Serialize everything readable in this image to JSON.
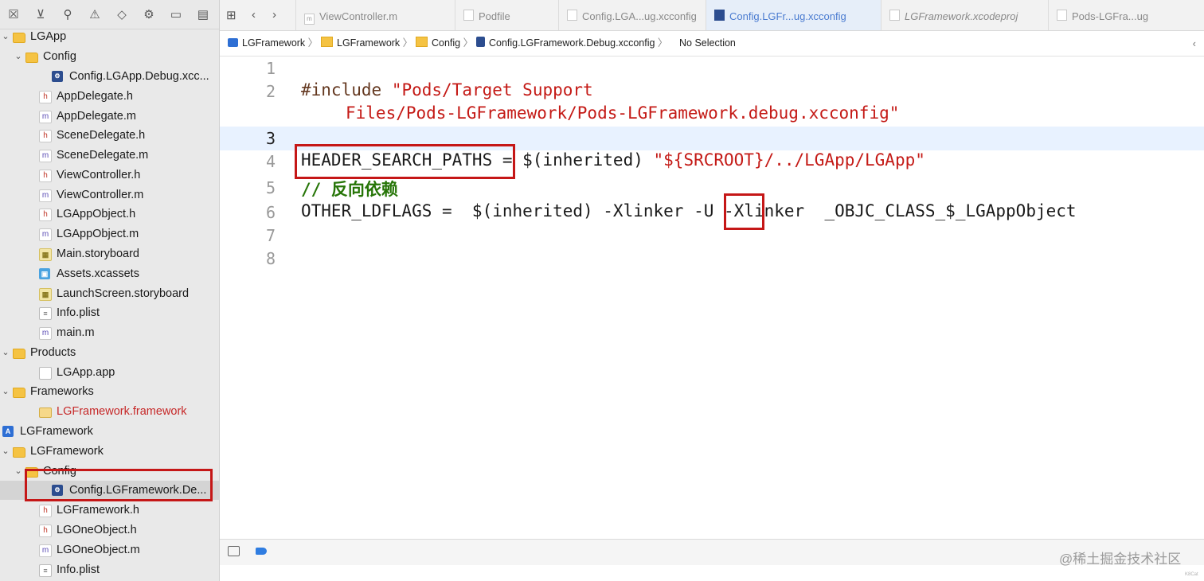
{
  "navigator": {
    "toolbar_icons": [
      "close-box-icon",
      "hierarchy-icon",
      "search-icon",
      "warning-icon",
      "diamond-icon",
      "test-icon",
      "breakpoint-icon",
      "report-icon"
    ],
    "rows": [
      {
        "label": "LGApp",
        "icon": "folder",
        "disclosure": "v",
        "red": false
      },
      {
        "label": "Config",
        "icon": "folder",
        "disclosure": "v",
        "red": false
      },
      {
        "label": "Config.LGApp.Debug.xcc...",
        "icon": "cfg",
        "disclosure": "",
        "red": false
      },
      {
        "label": "AppDelegate.h",
        "icon": "h",
        "disclosure": "",
        "red": false
      },
      {
        "label": "AppDelegate.m",
        "icon": "m",
        "disclosure": "",
        "red": false
      },
      {
        "label": "SceneDelegate.h",
        "icon": "h",
        "disclosure": "",
        "red": false
      },
      {
        "label": "SceneDelegate.m",
        "icon": "m",
        "disclosure": "",
        "red": false
      },
      {
        "label": "ViewController.h",
        "icon": "h",
        "disclosure": "",
        "red": false
      },
      {
        "label": "ViewController.m",
        "icon": "m",
        "disclosure": "",
        "red": false
      },
      {
        "label": "LGAppObject.h",
        "icon": "h",
        "disclosure": "",
        "red": false
      },
      {
        "label": "LGAppObject.m",
        "icon": "m",
        "disclosure": "",
        "red": false
      },
      {
        "label": "Main.storyboard",
        "icon": "sb",
        "disclosure": "",
        "red": false
      },
      {
        "label": "Assets.xcassets",
        "icon": "assets",
        "disclosure": "",
        "red": false
      },
      {
        "label": "LaunchScreen.storyboard",
        "icon": "sb",
        "disclosure": "",
        "red": false
      },
      {
        "label": "Info.plist",
        "icon": "plist",
        "disclosure": "",
        "red": false
      },
      {
        "label": "main.m",
        "icon": "m",
        "disclosure": "",
        "red": false
      },
      {
        "label": "Products",
        "icon": "folder",
        "disclosure": "v",
        "red": false
      },
      {
        "label": "LGApp.app",
        "icon": "app",
        "disclosure": "",
        "red": false
      },
      {
        "label": "Frameworks",
        "icon": "folder",
        "disclosure": "v",
        "red": false
      },
      {
        "label": "LGFramework.framework",
        "icon": "fw",
        "disclosure": "",
        "red": true
      },
      {
        "label": "LGFramework",
        "icon": "proj",
        "disclosure": "",
        "red": false
      },
      {
        "label": "LGFramework",
        "icon": "folder",
        "disclosure": "v",
        "red": false
      },
      {
        "label": "Config",
        "icon": "folder",
        "disclosure": "v",
        "red": false
      },
      {
        "label": "Config.LGFramework.De...",
        "icon": "cfg",
        "disclosure": "",
        "red": false
      },
      {
        "label": "LGFramework.h",
        "icon": "h",
        "disclosure": "",
        "red": false
      },
      {
        "label": "LGOneObject.h",
        "icon": "h",
        "disclosure": "",
        "red": false
      },
      {
        "label": "LGOneObject.m",
        "icon": "m",
        "disclosure": "",
        "red": false
      },
      {
        "label": "Info.plist",
        "icon": "plist",
        "disclosure": "",
        "red": false
      }
    ]
  },
  "tabs": [
    {
      "label": "ViewController.m",
      "glyph": "m",
      "active": false
    },
    {
      "label": "Podfile",
      "glyph": "",
      "active": false
    },
    {
      "label": "Config.LGA...ug.xcconfig",
      "glyph": "",
      "active": false
    },
    {
      "label": "Config.LGFr...ug.xcconfig",
      "glyph": "",
      "active": true
    },
    {
      "label": "LGFramework.xcodeproj",
      "glyph": "",
      "active": false
    },
    {
      "label": "Pods-LGFra...ug",
      "glyph": "",
      "active": false
    }
  ],
  "jumpbar": {
    "items": [
      "LGFramework",
      "LGFramework",
      "Config",
      "Config.LGFramework.Debug.xcconfig",
      "No Selection"
    ]
  },
  "editor": {
    "line_numbers": [
      "1",
      "2",
      "",
      "3",
      "4",
      "5",
      "6",
      "7",
      "8"
    ],
    "include_kw": "#include",
    "include_str_1": "\"Pods/Target Support",
    "include_str_2": "Files/Pods-LGFramework/Pods-LGFramework.debug.xcconfig\"",
    "line4_key": "HEADER_SEARCH_PATHS",
    "line4_mid": " = $(inherited) ",
    "line4_str": "\"${SRCROOT}/../LGApp/LGApp\"",
    "line5_comment": "// 反向依赖",
    "line6_a": "OTHER_LDFLAGS =  $(inherited) -Xlinker ",
    "line6_flag": "-U",
    "line6_b": " -Xlinker  _OBJC_CLASS_$_LGAppObject"
  },
  "watermark": "@稀土掘金技术社区",
  "corner_note": "K8Cat"
}
